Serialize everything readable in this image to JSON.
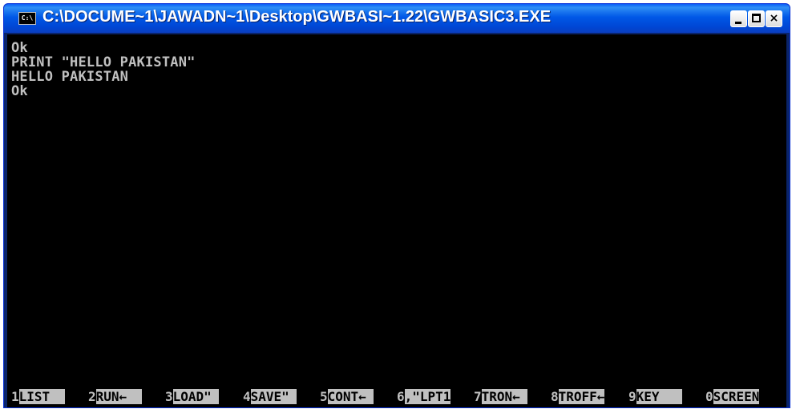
{
  "window": {
    "title": "C:\\DOCUME~1\\JAWADN~1\\Desktop\\GWBASI~1.22\\GWBASIC3.EXE",
    "icon_text": "C:\\",
    "icon": "console-icon",
    "controls": {
      "minimize_icon": "minimize-icon",
      "maximize_icon": "maximize-icon",
      "close_glyph": "×"
    }
  },
  "console": {
    "lines": [
      "Ok",
      "PRINT \"HELLO PAKISTAN\"",
      "HELLO PAKISTAN",
      "Ok"
    ]
  },
  "function_keys": [
    {
      "num": "1",
      "label": "LIST  "
    },
    {
      "num": "2",
      "label": "RUN←  "
    },
    {
      "num": "3",
      "label": "LOAD\" "
    },
    {
      "num": "4",
      "label": "SAVE\" "
    },
    {
      "num": "5",
      "label": "CONT← "
    },
    {
      "num": "6",
      "label": ",\"LPT1"
    },
    {
      "num": "7",
      "label": "TRON← "
    },
    {
      "num": "8",
      "label": "TROFF←"
    },
    {
      "num": "9",
      "label": "KEY   "
    },
    {
      "num": "0",
      "label": "SCREEN"
    }
  ],
  "colors": {
    "titlebar": "#0058e7",
    "console_bg": "#000000",
    "console_fg": "#c0c0c0"
  }
}
